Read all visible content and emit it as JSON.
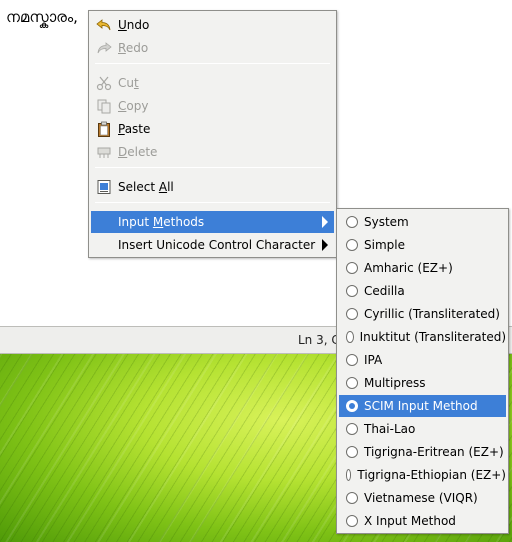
{
  "editor": {
    "text": "നമസ്കാരം,"
  },
  "statusbar": {
    "position": "Ln 3, C"
  },
  "context_menu": {
    "undo": {
      "pre": "",
      "u": "U",
      "post": "ndo",
      "icon": "undo-icon"
    },
    "redo": {
      "pre": "",
      "u": "R",
      "post": "edo",
      "icon": "redo-icon"
    },
    "cut": {
      "pre": "Cu",
      "u": "t",
      "post": "",
      "icon": "scissors-icon"
    },
    "copy": {
      "pre": "",
      "u": "C",
      "post": "opy",
      "icon": "copy-icon"
    },
    "paste": {
      "pre": "",
      "u": "P",
      "post": "aste",
      "icon": "clipboard-icon"
    },
    "delete": {
      "pre": "",
      "u": "D",
      "post": "elete",
      "icon": "delete-icon"
    },
    "select_all": {
      "pre": "Select ",
      "u": "A",
      "post": "ll",
      "icon": "select-all-icon"
    },
    "input_methods": {
      "pre": "Input ",
      "u": "M",
      "post": "ethods"
    },
    "insert_unicode": {
      "pre": "Insert Unicode Control Character",
      "u": "",
      "post": ""
    }
  },
  "input_methods_menu": {
    "items": [
      "System",
      "Simple",
      "Amharic (EZ+)",
      "Cedilla",
      "Cyrillic (Transliterated)",
      "Inuktitut (Transliterated)",
      "IPA",
      "Multipress",
      "SCIM Input Method",
      "Thai-Lao",
      "Tigrigna-Eritrean (EZ+)",
      "Tigrigna-Ethiopian (EZ+)",
      "Vietnamese (VIQR)",
      "X Input Method"
    ],
    "selected": "SCIM Input Method"
  },
  "colors": {
    "selection": "#3d7fd7",
    "menu_bg": "#f2f2f0",
    "disabled_text": "#9c9c98"
  }
}
